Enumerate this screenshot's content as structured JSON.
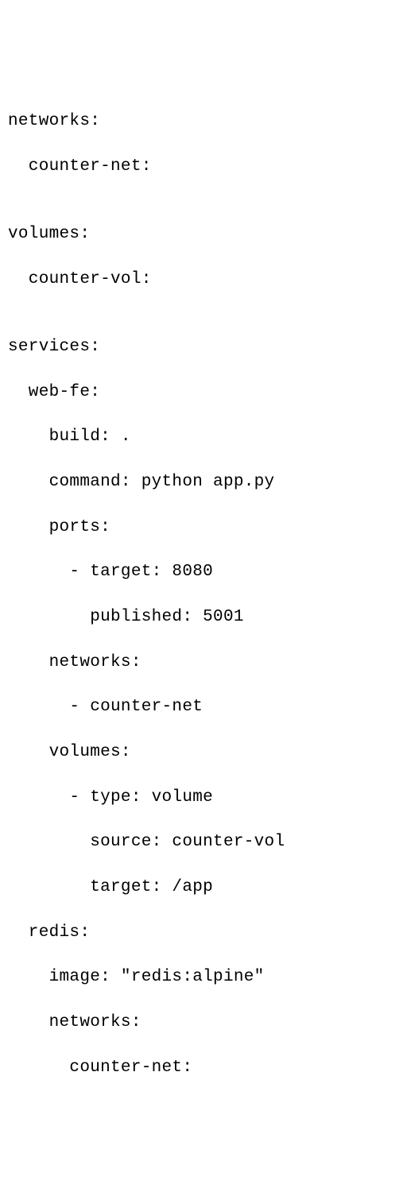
{
  "lines": {
    "l1": "networks:",
    "l2": "  counter-net:",
    "l3": "",
    "l4": "volumes:",
    "l5": "  counter-vol:",
    "l6": "",
    "l7": "services:",
    "l8": "  web-fe:",
    "l9": "    build: .",
    "l10": "    command: python app.py",
    "l11": "    ports:",
    "l12": "      - target: 8080",
    "l13": "        published: 5001",
    "l14": "    networks:",
    "l15": "      - counter-net",
    "l16": "    volumes:",
    "l17": "      - type: volume",
    "l18": "        source: counter-vol",
    "l19": "        target: /app",
    "l20": "  redis:",
    "l21": "    image: \"redis:alpine\"",
    "l22": "    networks:",
    "l23": "      counter-net:"
  }
}
